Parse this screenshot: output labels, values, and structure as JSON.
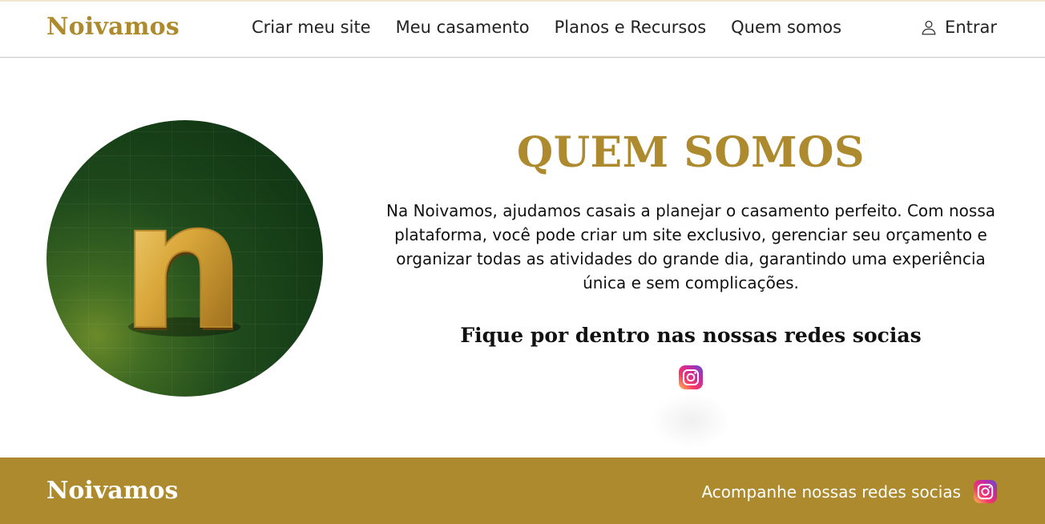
{
  "header": {
    "logo": "Noivamos",
    "nav": [
      "Criar meu site",
      "Meu casamento",
      "Planos e Recursos",
      "Quem somos"
    ],
    "login_label": "Entrar",
    "login_icon": "user-icon"
  },
  "about": {
    "image_letter": "n",
    "title": "QUEM SOMOS",
    "description": "Na Noivamos, ajudamos casais a planejar o casamento perfeito. Com nossa plataforma, você pode criar um site exclusivo, gerenciar seu orçamento e organizar todas as atividades do grande dia, garantindo uma experiência única e sem complicações.",
    "social_heading": "Fique por dentro nas nossas redes socias",
    "social_icon": "instagram-icon"
  },
  "footer": {
    "logo": "Noivamos",
    "social_text": "Acompanhe nossas redes socias",
    "social_icon": "instagram-icon"
  },
  "colors": {
    "brand_gold": "#ad8a2d",
    "dark_green": "#133a15",
    "text": "#111111"
  }
}
